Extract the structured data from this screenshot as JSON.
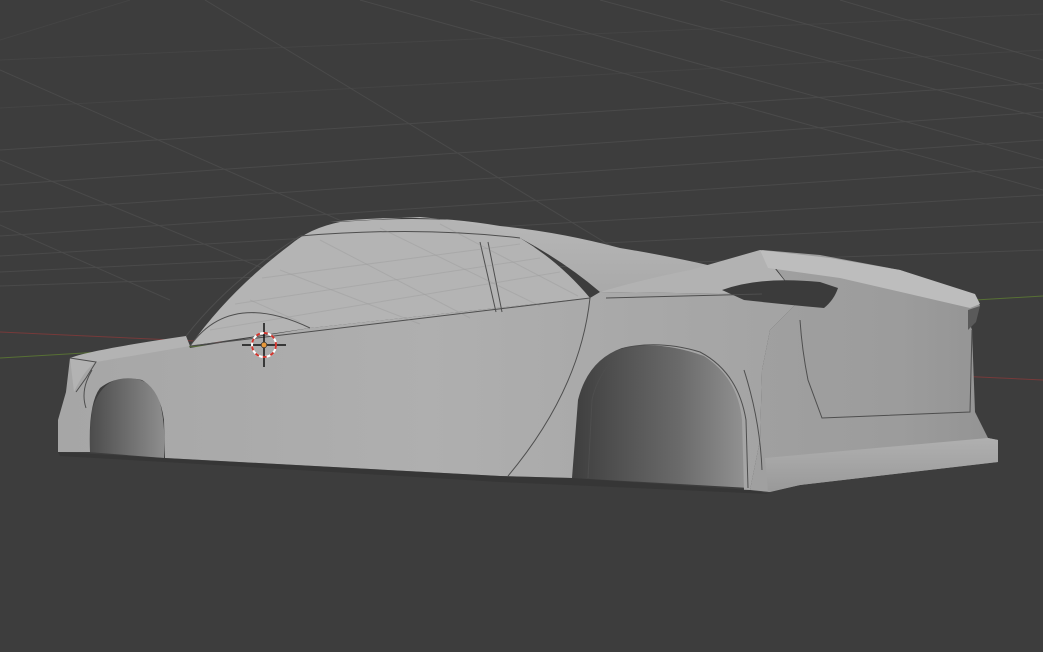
{
  "viewport": {
    "background_color": "#3d3d3d",
    "grid_color": "#4a4a4a",
    "axis_x_color": "#8a3a3a",
    "axis_y_color": "#5e7d33"
  },
  "scene_object": {
    "type": "car-body-mesh",
    "material_color": "#a9a9a9",
    "shadow_color": "#2f2f2f"
  },
  "cursor_3d": {
    "icon": "3d-cursor-icon",
    "ring_colors": [
      "#ffffff",
      "#d0342c"
    ]
  }
}
